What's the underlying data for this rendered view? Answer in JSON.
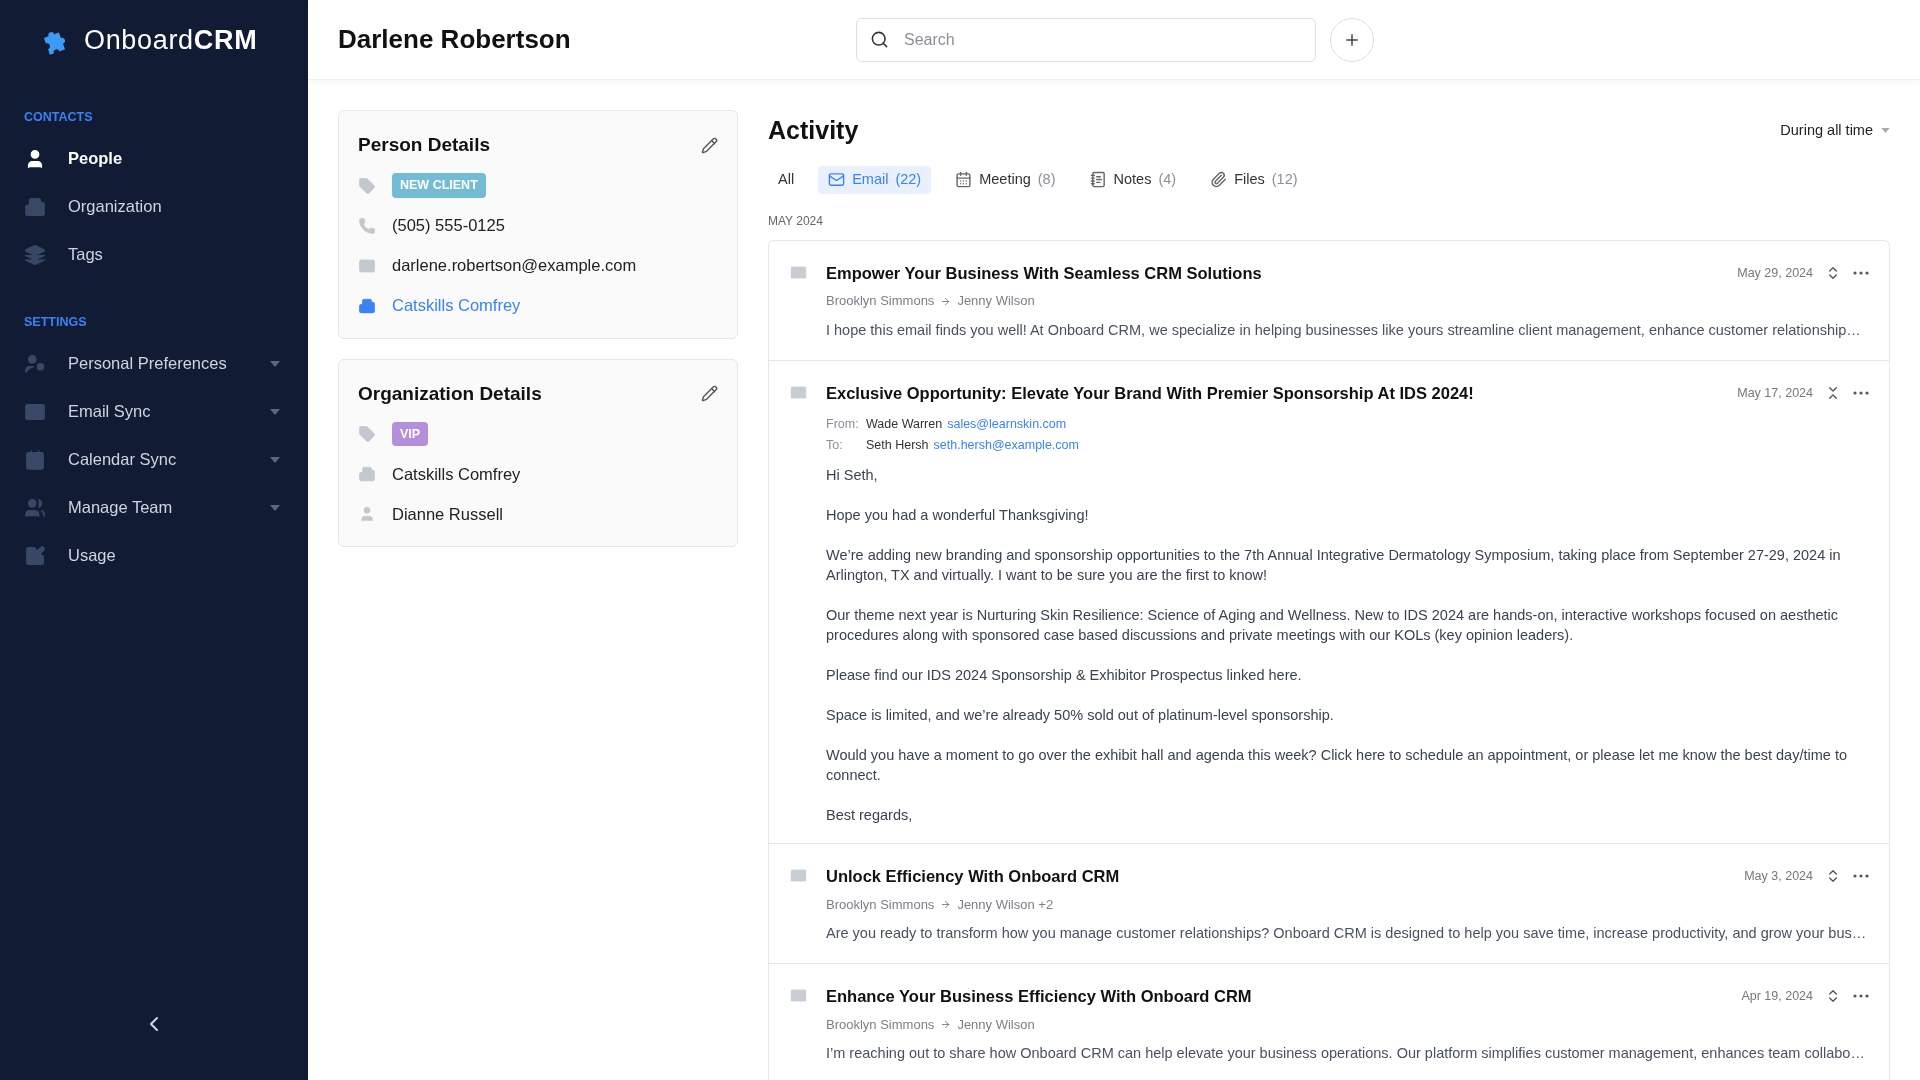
{
  "sidebar": {
    "logo": "Onboard**CRM**",
    "sections": [
      {
        "heading": "CONTACTS",
        "items": [
          {
            "label": "People",
            "selected": true,
            "expandable": false
          },
          {
            "label": "Organization",
            "selected": false,
            "expandable": false
          },
          {
            "label": "Tags",
            "selected": false,
            "expandable": false
          }
        ]
      },
      {
        "heading": "SETTINGS",
        "items": [
          {
            "label": "Personal Preferences",
            "selected": false,
            "expandable": true
          },
          {
            "label": "Email Sync",
            "selected": false,
            "expandable": true
          },
          {
            "label": "Calendar Sync",
            "selected": false,
            "expandable": true
          },
          {
            "label": "Manage Team",
            "selected": false,
            "expandable": true
          },
          {
            "label": "Usage",
            "selected": false,
            "expandable": false
          }
        ]
      }
    ]
  },
  "header": {
    "title": "Darlene Robertson",
    "search": {
      "placeholder": "Search"
    }
  },
  "person_details": {
    "title": "Person Details",
    "tag": {
      "label": "NEW CLIENT",
      "color": "#74bcd6"
    },
    "phone": "(505) 555-0125",
    "email": "darlene.robertson@example.com",
    "company": "Catskills Comfrey"
  },
  "organization_details": {
    "title": "Organization Details",
    "tag": {
      "label": "VIP",
      "color": "#b48fdb"
    },
    "company": "Catskills Comfrey",
    "contact": "Dianne Russell"
  },
  "activity": {
    "title": "Activity",
    "period": "During all time",
    "tabs": [
      {
        "label": "All",
        "selected": false
      },
      {
        "label": "Email",
        "count": "(22)",
        "selected": true
      },
      {
        "label": "Meeting",
        "count": "(8)",
        "selected": false
      },
      {
        "label": "Notes",
        "count": "(4)",
        "selected": false
      },
      {
        "label": "Files",
        "count": "(12)",
        "selected": false
      }
    ],
    "group_label": "MAY 2024",
    "emails": [
      {
        "subject": "Empower Your Business With Seamless CRM Solutions",
        "date": "May 29, 2024",
        "expanded": false,
        "sender": "Brooklyn Simmons",
        "recipient": "Jenny Wilson",
        "preview": "I hope this email finds you well! At Onboard CRM, we specialize in helping businesses like yours streamline client management, enhance customer relationship…"
      },
      {
        "subject": "Exclusive Opportunity: Elevate Your Brand With Premier Sponsorship At IDS 2024!",
        "date": "May 17, 2024",
        "expanded": true,
        "from_label": "From:",
        "sender": "Wade Warren",
        "sender_email": "sales@learnskin.com",
        "to_label": "To:",
        "recipient": "Seth Hersh",
        "recipient_email": "seth.hersh@example.com",
        "body": [
          "Hi Seth,",
          "Hope you had a wonderful Thanksgiving!",
          "We’re adding new branding and sponsorship opportunities to the 7th Annual Integrative Dermatology Symposium, taking place from September 27-29, 2024 in Arlington, TX and virtually. I want to be sure you are the first to know!",
          "Our theme next year is Nurturing Skin Resilience: Science of Aging and Wellness. New to IDS 2024 are hands-on, interactive workshops focused on aesthetic procedures along with sponsored case based discussions and private meetings with our KOLs (key opinion leaders).",
          "Please find our IDS 2024 Sponsorship & Exhibitor Prospectus linked here.",
          "Space is limited, and we’re already 50% sold out of platinum-level sponsorship.",
          "Would you have a moment to go over the exhibit hall and agenda this week? Click here to schedule an appointment, or please let me know the best day/time to connect.",
          "Best regards,"
        ]
      },
      {
        "subject": "Unlock Efficiency With Onboard CRM",
        "date": "May 3, 2024",
        "expanded": false,
        "sender": "Brooklyn Simmons",
        "recipient": "Jenny Wilson +2",
        "preview": "Are you ready to transform how you manage customer relationships? Onboard CRM is designed to help you save time, increase productivity, and grow your bus…"
      },
      {
        "subject": "Enhance Your Business Efficiency With Onboard CRM",
        "date": "Apr 19, 2024",
        "expanded": false,
        "sender": "Brooklyn Simmons",
        "recipient": "Jenny Wilson",
        "preview": "I’m reaching out to share how Onboard CRM can help elevate your business operations. Our platform simplifies customer management, enhances team collabo…"
      }
    ]
  }
}
